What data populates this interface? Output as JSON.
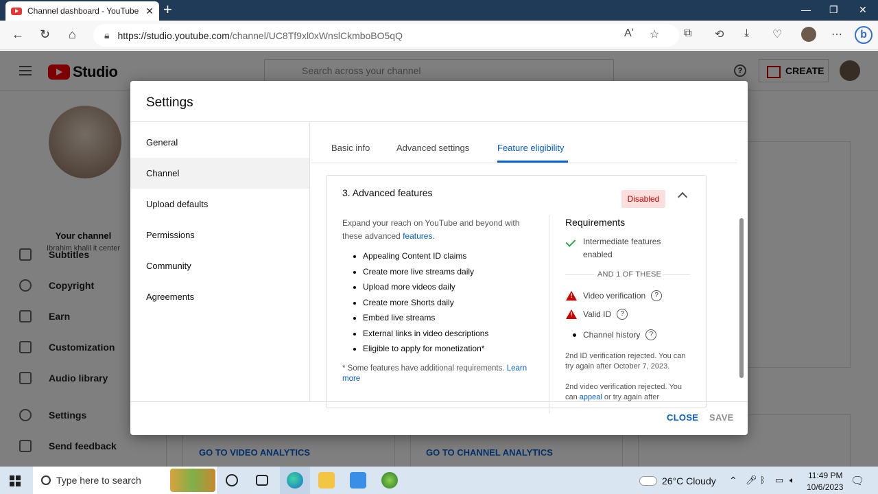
{
  "browser": {
    "tab_title": "Channel dashboard - YouTube St",
    "url_host": "https://studio.youtube.com",
    "url_path": "/channel/UC8Tf9xl0xWnslCkmboBO5qQ",
    "reader_label": "Aʼ"
  },
  "studio": {
    "logo": "Studio",
    "search_placeholder": "Search across your channel",
    "create_label": "CREATE",
    "your_channel": "Your channel",
    "channel_name": "Ibrahim khalil it center",
    "sidebar": {
      "items": [
        {
          "label": "Subtitles"
        },
        {
          "label": "Copyright"
        },
        {
          "label": "Earn"
        },
        {
          "label": "Customization"
        },
        {
          "label": "Audio library"
        },
        {
          "label": "Settings"
        },
        {
          "label": "Send feedback"
        }
      ]
    },
    "go_video": "GO TO VIDEO ANALYTICS",
    "go_channel": "GO TO CHANNEL ANALYTICS"
  },
  "modal": {
    "title": "Settings",
    "nav": [
      "General",
      "Channel",
      "Upload defaults",
      "Permissions",
      "Community",
      "Agreements"
    ],
    "tabs": [
      "Basic info",
      "Advanced settings",
      "Feature eligibility"
    ],
    "section_title": "3. Advanced features",
    "status": "Disabled",
    "desc_text": "Expand your reach on YouTube and beyond with these advanced ",
    "desc_link": "features",
    "desc_end": ".",
    "features": [
      "Appealing Content ID claims",
      "Create more live streams daily",
      "Upload more videos daily",
      "Create more Shorts daily",
      "Embed live streams",
      "External links in video descriptions",
      "Eligible to apply for monetization*"
    ],
    "footnote_text": "* Some features have additional requirements. ",
    "footnote_link": "Learn more",
    "requirements_title": "Requirements",
    "req_intermediate": "Intermediate features enabled",
    "and_one": "AND 1 OF THESE",
    "req_video": "Video verification",
    "req_id": "Valid ID",
    "req_history": "Channel history",
    "rej1": "2nd ID verification rejected. You can try again after October 7, 2023.",
    "rej2_a": "2nd video verification rejected. You can ",
    "rej2_link": "appeal",
    "rej2_b": " or try again after",
    "close_label": "CLOSE",
    "save_label": "SAVE"
  },
  "taskbar": {
    "search_placeholder": "Type here to search",
    "weather": "26°C  Cloudy",
    "time": "11:49 PM",
    "date": "10/6/2023"
  },
  "colors": {
    "accent": "#065fd4",
    "disabled_badge_bg": "#fcdedc",
    "warning": "#cc0000",
    "success": "#2ba640"
  }
}
